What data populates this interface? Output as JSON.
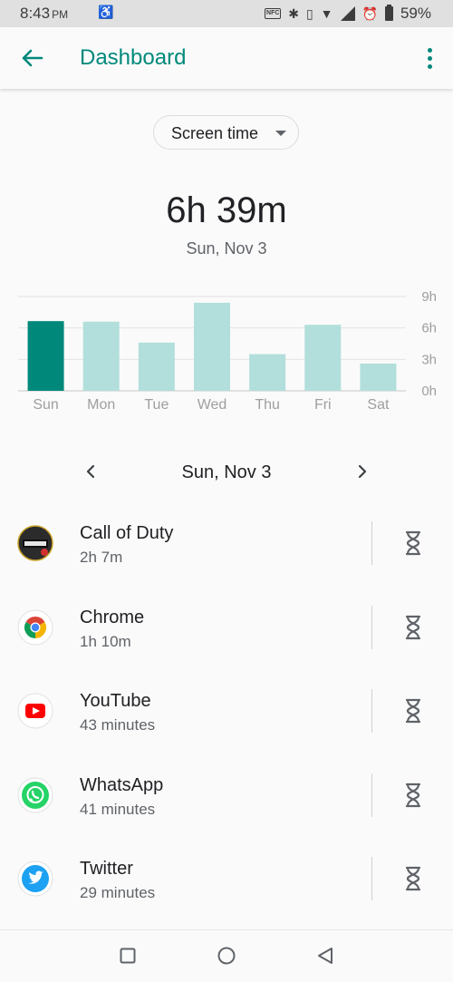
{
  "status_bar": {
    "time": "8:43",
    "ampm": "PM",
    "battery": "59%",
    "nfc_label": "NFC",
    "icons": [
      "accessibility-icon",
      "nfc-icon",
      "bluetooth-icon",
      "vibrate-icon",
      "wifi-icon",
      "signal-icon",
      "alarm-icon",
      "battery-icon"
    ]
  },
  "app_bar": {
    "title": "Dashboard",
    "back_icon": "arrow-back-icon",
    "menu_icon": "more-vert-icon"
  },
  "selector": {
    "value": "Screen time"
  },
  "summary": {
    "total": "6h 39m",
    "date": "Sun, Nov 3"
  },
  "chart_data": {
    "type": "bar",
    "categories": [
      "Sun",
      "Mon",
      "Tue",
      "Wed",
      "Thu",
      "Fri",
      "Sat"
    ],
    "values": [
      6.65,
      6.6,
      4.6,
      8.4,
      3.5,
      6.3,
      2.6
    ],
    "y_ticks": [
      "0h",
      "3h",
      "6h",
      "9h"
    ],
    "ylim": [
      0,
      9
    ],
    "selected_index": 0,
    "selected_color": "#00897b",
    "bar_color": "#b2dfdb",
    "grid": true
  },
  "day_nav": {
    "label": "Sun, Nov 3",
    "prev_icon": "chevron-left-icon",
    "next_icon": "chevron-right-icon"
  },
  "apps": [
    {
      "name": "Call of Duty",
      "time": "2h 7m",
      "icon": "call-of-duty-icon"
    },
    {
      "name": "Chrome",
      "time": "1h 10m",
      "icon": "chrome-icon"
    },
    {
      "name": "YouTube",
      "time": "43 minutes",
      "icon": "youtube-icon"
    },
    {
      "name": "WhatsApp",
      "time": "41 minutes",
      "icon": "whatsapp-icon"
    },
    {
      "name": "Twitter",
      "time": "29 minutes",
      "icon": "twitter-icon"
    }
  ],
  "colors": {
    "accent": "#00897b",
    "text_primary": "#202124",
    "text_secondary": "#5f6368"
  }
}
